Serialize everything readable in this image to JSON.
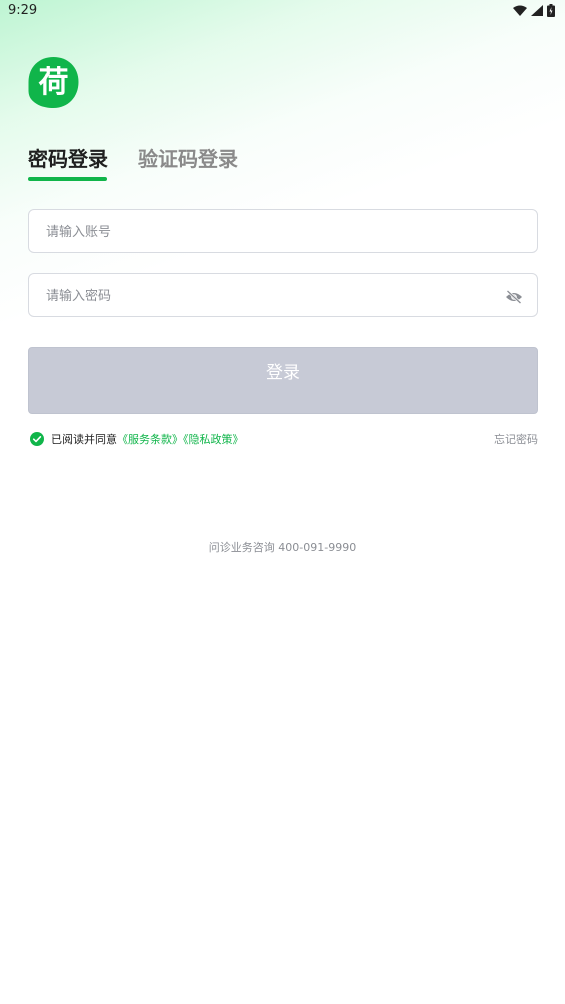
{
  "status_bar": {
    "time": "9:29",
    "icons": [
      "wifi-icon",
      "signal-icon",
      "battery-icon"
    ]
  },
  "logo": {
    "glyph": "荷",
    "color": "#10b54a",
    "icon": "lotus-logo-icon"
  },
  "tabs": [
    {
      "label": "密码登录",
      "active": true
    },
    {
      "label": "验证码登录",
      "active": false
    }
  ],
  "form": {
    "account_placeholder": "请输入账号",
    "account_value": "",
    "password_placeholder": "请输入密码",
    "password_value": "",
    "password_toggle_icon": "eye-off-icon"
  },
  "login_button": {
    "label": "登录"
  },
  "agreement": {
    "checked": true,
    "prefix": "已阅读并同意",
    "terms_link": "《服务条款》",
    "privacy_link": "《隐私政策》",
    "forgot_password": "忘记密码"
  },
  "footer": {
    "hotline": "问诊业务咨询 400-091-9990"
  },
  "colors": {
    "accent": "#10b54a",
    "button_disabled": "#c7cad6",
    "muted_text": "#8b8e94"
  }
}
